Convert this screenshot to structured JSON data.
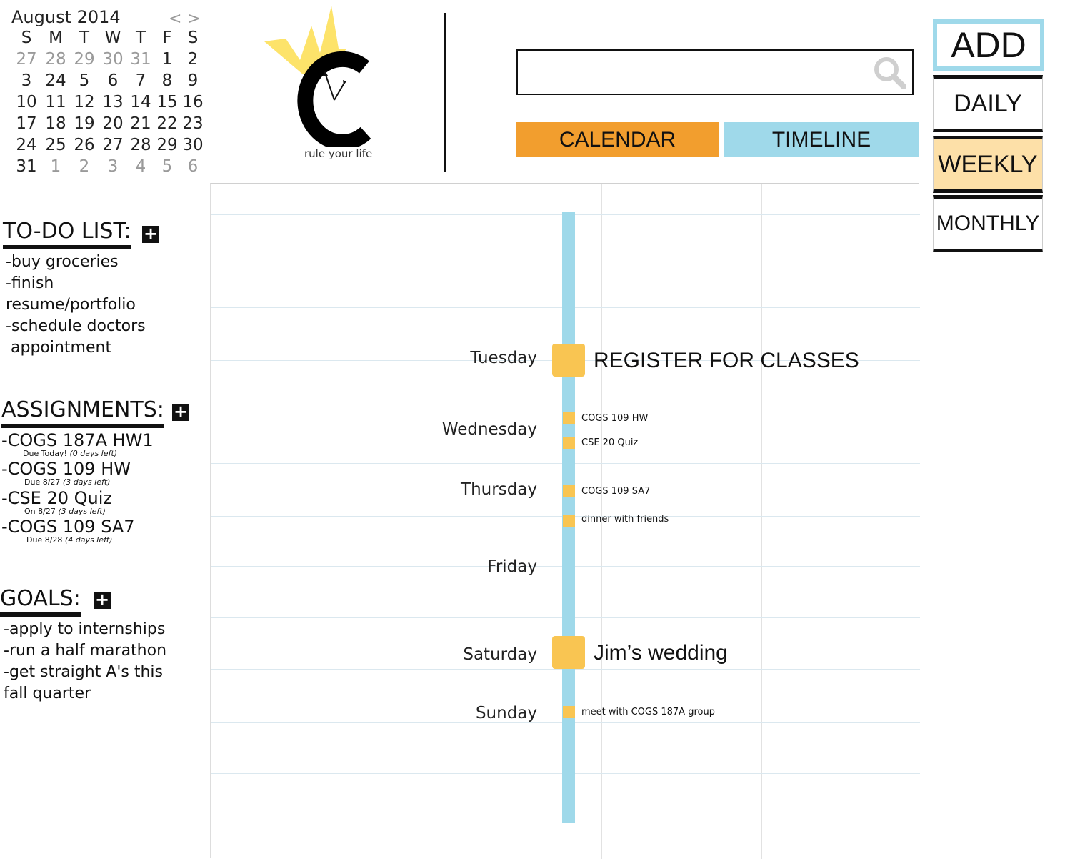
{
  "mini_calendar": {
    "month_label": "August 2014",
    "prev_label": "<",
    "next_label": ">",
    "weekdays": [
      "S",
      "M",
      "T",
      "W",
      "T",
      "F",
      "S"
    ],
    "weeks": [
      [
        "27",
        "28",
        "29",
        "30",
        "31",
        "1",
        "2"
      ],
      [
        "3",
        "24",
        "5",
        "6",
        "7",
        "8",
        "9"
      ],
      [
        "10",
        "11",
        "12",
        "13",
        "14",
        "15",
        "16"
      ],
      [
        "17",
        "18",
        "19",
        "20",
        "21",
        "22",
        "23"
      ],
      [
        "24",
        "25",
        "26",
        "27",
        "28",
        "29",
        "30"
      ],
      [
        "31",
        "1",
        "2",
        "3",
        "4",
        "5",
        "6"
      ]
    ],
    "muted": [
      [
        true,
        true,
        true,
        true,
        true,
        false,
        false
      ],
      [
        false,
        false,
        false,
        false,
        false,
        false,
        false
      ],
      [
        false,
        false,
        false,
        false,
        false,
        false,
        false
      ],
      [
        false,
        false,
        false,
        false,
        false,
        false,
        false
      ],
      [
        false,
        false,
        false,
        false,
        false,
        false,
        false
      ],
      [
        false,
        true,
        true,
        true,
        true,
        true,
        true
      ]
    ]
  },
  "logo": {
    "letter": "C",
    "tagline": "rule your life"
  },
  "search": {
    "value": "",
    "placeholder": ""
  },
  "tabs": {
    "calendar": "CALENDAR",
    "timeline": "TIMELINE"
  },
  "right_nav": {
    "add": "ADD",
    "daily": "DAILY",
    "weekly": "WEEKLY",
    "monthly": "MONTHLY",
    "selected": "WEEKLY"
  },
  "todo": {
    "title": "TO-DO LIST:",
    "add": "+",
    "lines": [
      "-buy groceries",
      "-finish",
      "resume/portfolio",
      "-schedule doctors",
      " appointment"
    ]
  },
  "assignments": {
    "title": "ASSIGNMENTS:",
    "add": "+",
    "items": [
      {
        "name": "-COGS 187A HW1",
        "due": "Due Today!",
        "left": "(0 days left)"
      },
      {
        "name": "-COGS 109 HW",
        "due": "Due 8/27",
        "left": "(3 days left)"
      },
      {
        "name": "-CSE 20 Quiz",
        "due": "On 8/27",
        "left": "(3 days left)"
      },
      {
        "name": "-COGS 109 SA7",
        "due": "Due 8/28",
        "left": "(4 days left)"
      }
    ]
  },
  "goals": {
    "title": "GOALS:",
    "add": "+",
    "lines": [
      "-apply to internships",
      "-run a half marathon",
      "-get straight A's this",
      "fall quarter"
    ]
  },
  "timeline": {
    "days": [
      "Tuesday",
      "Wednesday",
      "Thursday",
      "Friday",
      "Saturday",
      "Sunday"
    ],
    "events": [
      {
        "day": "Tuesday",
        "title": "REGISTER FOR CLASSES",
        "size": "large"
      },
      {
        "day": "Wednesday",
        "title": "COGS 109 HW",
        "size": "small"
      },
      {
        "day": "Wednesday",
        "title": "CSE 20 Quiz",
        "size": "small"
      },
      {
        "day": "Thursday",
        "title": "COGS 109 SA7",
        "size": "small"
      },
      {
        "day": "Thursday",
        "title": "dinner with friends",
        "size": "small"
      },
      {
        "day": "Saturday",
        "title": "Jim’s wedding",
        "size": "large"
      },
      {
        "day": "Sunday",
        "title": "meet with COGS 187A group",
        "size": "small"
      }
    ]
  },
  "colors": {
    "calendar_tab": "#f29e2e",
    "timeline_tab": "#9fd9ea",
    "timeline_bar": "#9fd9ea",
    "event_marker": "#f9c552",
    "weekly_selected": "#fde0a8",
    "crown": "#fde36a"
  },
  "icons": {
    "search": "search-icon",
    "add": "plus-icon",
    "logo": "crown-clock-logo"
  }
}
